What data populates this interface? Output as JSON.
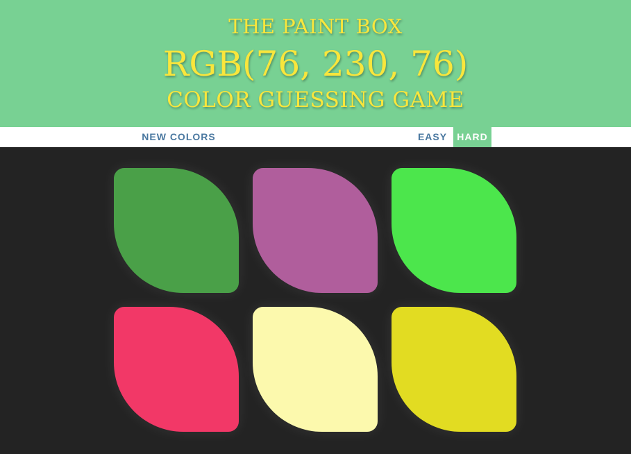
{
  "header": {
    "title_line1": "THE PAINT BOX",
    "target_rgb": "RGB(76, 230, 76)",
    "title_line3": "COLOR GUESSING GAME",
    "background": "#78d193",
    "text_color": "#f9e63c"
  },
  "controls": {
    "new_colors_label": "NEW COLORS",
    "easy_label": "EASY",
    "hard_label": "HARD",
    "selected_mode": "HARD"
  },
  "squares": [
    {
      "color": "#4aa048"
    },
    {
      "color": "#b05e9c"
    },
    {
      "color": "#4ce64c"
    },
    {
      "color": "#f23867"
    },
    {
      "color": "#fcf9ad"
    },
    {
      "color": "#e2dc22"
    }
  ]
}
